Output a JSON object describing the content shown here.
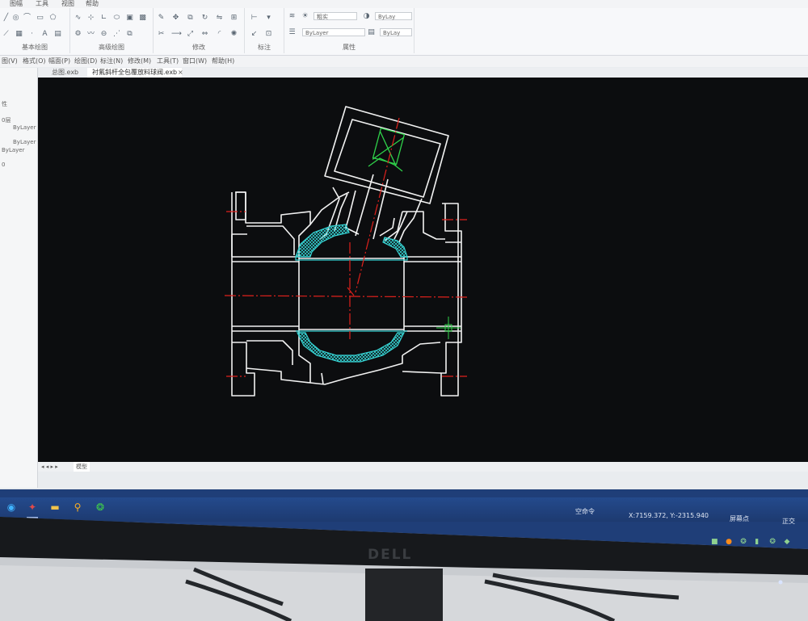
{
  "menu_tabs": [
    "图幅",
    "工具",
    "视图",
    "帮助"
  ],
  "ribbon": {
    "groups": [
      {
        "label": "基本绘图"
      },
      {
        "label": "高级绘图"
      },
      {
        "label": "修改"
      },
      {
        "label": "标注"
      },
      {
        "label": "属性"
      }
    ],
    "line_style_combo": "粗实",
    "color_combo": "ByLay",
    "linetype_combo": "ByLayer",
    "lineweight_combo": "ByLay"
  },
  "menubar": [
    "图(V)",
    "格式(O)",
    "幅面(P)",
    "绘图(D)",
    "标注(N)",
    "修改(M)",
    "工具(T)",
    "窗口(W)",
    "帮助(H)"
  ],
  "file_tabs": [
    {
      "label": "总图.exb",
      "active": false
    },
    {
      "label": "衬氟斜杆全包覆放料球阀.exb",
      "active": true
    }
  ],
  "left_panel": {
    "items": [
      "性",
      "0层",
      "ByLayer",
      "ByLayer",
      "ByLayer",
      "0"
    ]
  },
  "layout_tab": "模型",
  "status": {
    "command": "空命令",
    "coordinates": "X:7159.372, Y:-2315.940",
    "snap_mode": "屏幕点",
    "ortho_mode": "正交"
  },
  "monitor_brand": "DELL",
  "colors": {
    "canvas": "#0c0d0f",
    "outline": "#f2f2f2",
    "centerline": "#e0211c",
    "lining_hatch": "#36d3d3",
    "stem": "#2fd24a",
    "taskbar": "#1f3e78"
  }
}
